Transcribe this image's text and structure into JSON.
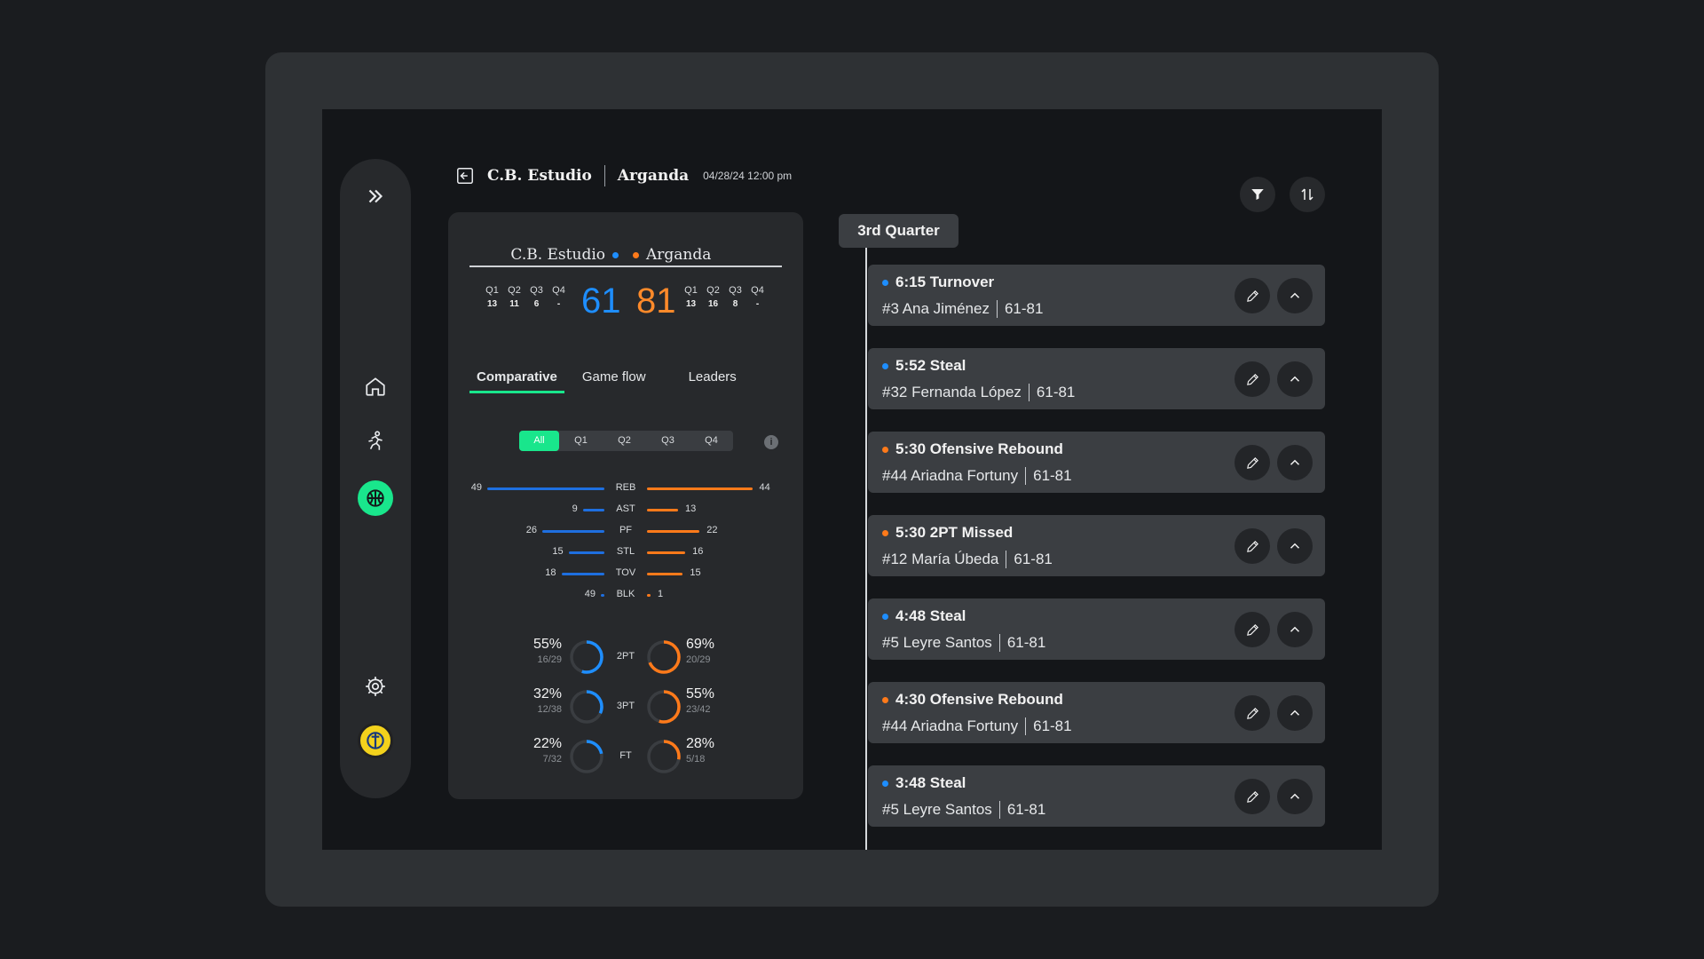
{
  "header": {
    "team_home": "C.B. Estudio",
    "team_away": "Arganda",
    "datetime": "04/28/24 12:00 pm"
  },
  "scoreboard": {
    "home_name": "C.B. Estudio",
    "away_name": "Arganda",
    "home_score": "61",
    "away_score": "81",
    "quarter_labels": [
      "Q1",
      "Q2",
      "Q3",
      "Q4"
    ],
    "home_quarters": [
      "13",
      "11",
      "6",
      "-"
    ],
    "away_quarters": [
      "13",
      "16",
      "8",
      "-"
    ],
    "home_color": "#1e8eff",
    "away_color": "#ff7a1a"
  },
  "tabs": [
    "Comparative",
    "Game flow",
    "Leaders"
  ],
  "quarter_filter": [
    "All",
    "Q1",
    "Q2",
    "Q3",
    "Q4"
  ],
  "comparison": [
    {
      "label": "REB",
      "home": "49",
      "away": "44"
    },
    {
      "label": "AST",
      "home": "9",
      "away": "13"
    },
    {
      "label": "PF",
      "home": "26",
      "away": "22"
    },
    {
      "label": "STL",
      "home": "15",
      "away": "16"
    },
    {
      "label": "TOV",
      "home": "18",
      "away": "15"
    },
    {
      "label": "BLK",
      "home": "49",
      "away": "1"
    }
  ],
  "shooting": [
    {
      "label": "2PT",
      "home_pct": "55%",
      "home_made": "16/29",
      "away_pct": "69%",
      "away_made": "20/29",
      "home_frac": 0.55,
      "away_frac": 0.69
    },
    {
      "label": "3PT",
      "home_pct": "32%",
      "home_made": "12/38",
      "away_pct": "55%",
      "away_made": "23/42",
      "home_frac": 0.32,
      "away_frac": 0.55
    },
    {
      "label": "FT",
      "home_pct": "22%",
      "home_made": "7/32",
      "away_pct": "28%",
      "away_made": "5/18",
      "home_frac": 0.22,
      "away_frac": 0.28
    }
  ],
  "timeline": {
    "quarter": "3rd Quarter",
    "events": [
      {
        "title": "6:15 Turnover",
        "player": "#3 Ana Jiménez",
        "score": "61-81",
        "team": "home"
      },
      {
        "title": "5:52 Steal",
        "player": "#32 Fernanda López",
        "score": "61-81",
        "team": "home"
      },
      {
        "title": "5:30 Ofensive Rebound",
        "player": "#44 Ariadna Fortuny",
        "score": "61-81",
        "team": "away"
      },
      {
        "title": "5:30 2PT Missed",
        "player": "#12 María Úbeda",
        "score": "61-81",
        "team": "away"
      },
      {
        "title": "4:48 Steal",
        "player": "#5 Leyre Santos",
        "score": "61-81",
        "team": "home"
      },
      {
        "title": "4:30 Ofensive Rebound",
        "player": "#44 Ariadna Fortuny",
        "score": "61-81",
        "team": "away"
      },
      {
        "title": "3:48 Steal",
        "player": "#5 Leyre Santos",
        "score": "61-81",
        "team": "home"
      }
    ]
  },
  "icons": {
    "sidebar": [
      "expand-icon",
      "home-icon",
      "player-icon",
      "basketball-icon",
      "settings-icon",
      "team-avatar"
    ],
    "actions": [
      "filter-icon",
      "sort-icon",
      "edit-icon",
      "collapse-icon",
      "back-icon",
      "info-icon"
    ]
  }
}
